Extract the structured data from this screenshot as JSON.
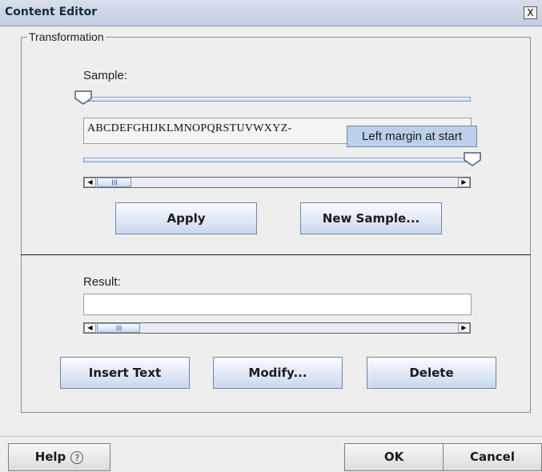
{
  "window": {
    "title": "Content Editor",
    "close_label": "X"
  },
  "transformation": {
    "legend": "Transformation",
    "sample_label": "Sample:",
    "sample_text": "ABCDEFGHIJKLMNOPQRSTUVWXYZ-",
    "tooltip": "Left margin at start",
    "left_slider_value": 0.0,
    "right_slider_value": 1.0,
    "apply_label": "Apply",
    "new_sample_label": "New Sample..."
  },
  "result": {
    "label": "Result:",
    "value": "",
    "insert_label": "Insert Text",
    "modify_label": "Modify...",
    "delete_label": "Delete"
  },
  "footer": {
    "help_label": "Help",
    "help_icon": "question-circle-icon",
    "ok_label": "OK",
    "cancel_label": "Cancel"
  },
  "icons": {
    "scroll_left": "scroll-left-icon",
    "scroll_right": "scroll-right-icon"
  }
}
